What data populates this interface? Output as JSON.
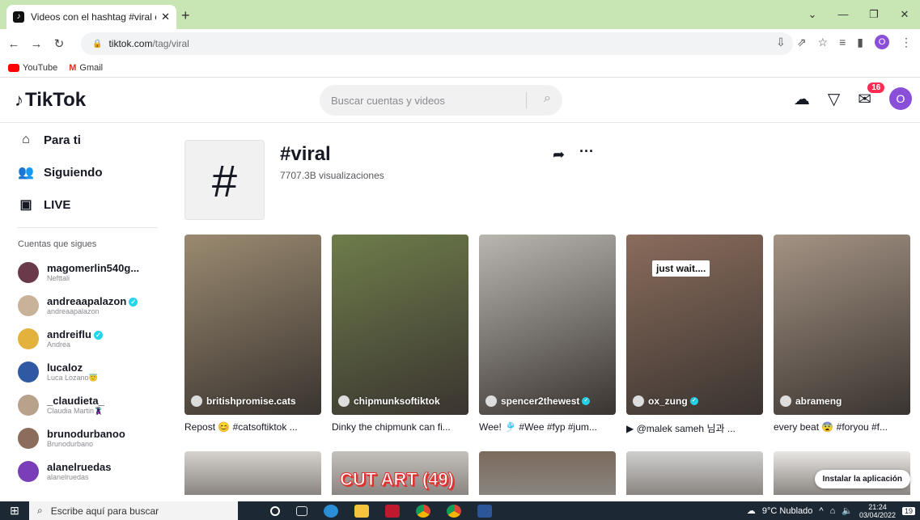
{
  "browser": {
    "tab_title": "Videos con el hashtag #viral en T",
    "tab_close": "✕",
    "new_tab": "+",
    "url_host": "tiktok.com",
    "url_path": "/tag/viral",
    "profile_initial": "O",
    "bookmarks": [
      "YouTube",
      "Gmail"
    ]
  },
  "header": {
    "logo": "TikTok",
    "search_placeholder": "Buscar cuentas y videos",
    "inbox_badge": "16",
    "user_initial": "O"
  },
  "sidebar": {
    "nav": [
      {
        "label": "Para ti",
        "icon": "home-icon",
        "glyph": "⌂"
      },
      {
        "label": "Siguiendo",
        "icon": "following-icon",
        "glyph": "👥"
      },
      {
        "label": "LIVE",
        "icon": "live-icon",
        "glyph": "▣"
      }
    ],
    "following_title": "Cuentas que sigues",
    "accounts": [
      {
        "name": "magomerlin540g...",
        "sub": "Nefttali",
        "verified": false,
        "color": "#6b3a4a"
      },
      {
        "name": "andreaapalazon",
        "sub": "andreaapalazon",
        "verified": true,
        "color": "#c9b29a"
      },
      {
        "name": "andreiflu",
        "sub": "Andrea",
        "verified": true,
        "color": "#e3b23c"
      },
      {
        "name": "lucaloz",
        "sub": "Luca Lozano😇",
        "verified": false,
        "color": "#2f5aa3"
      },
      {
        "name": "_claudieta_",
        "sub": "Claudia Martin🦹",
        "verified": false,
        "color": "#b9a28c"
      },
      {
        "name": "brunodurbanoo",
        "sub": "Brunodurbano",
        "verified": false,
        "color": "#8c6c5a"
      },
      {
        "name": "alanelruedas",
        "sub": "alanelruedas",
        "verified": false,
        "color": "#7a3fb8"
      }
    ]
  },
  "tag": {
    "symbol": "#",
    "name": "#viral",
    "views": "7707.3B visualizaciones"
  },
  "videos": [
    {
      "author": "britishpromise.cats",
      "verified": false,
      "caption": "Repost 😊 #catsoftiktok ...",
      "bg": "#9a8a70",
      "overlay": ""
    },
    {
      "author": "chipmunksoftiktok",
      "verified": false,
      "caption": "Dinky the chipmunk can fi...",
      "bg": "#6e7d4a",
      "overlay": ""
    },
    {
      "author": "spencer2thewest",
      "verified": true,
      "caption": "Wee! 🎐 #Wee #fyp #jum...",
      "bg": "#b9b6b0",
      "overlay": ""
    },
    {
      "author": "ox_zung",
      "verified": true,
      "caption": "▶ @malek sameh 님과 ...",
      "bg": "#8a6c5c",
      "overlay": "just wait...."
    },
    {
      "author": "abrameng",
      "verified": false,
      "caption": "every beat 😨 #foryou #f...",
      "bg": "#a49384",
      "overlay": ""
    }
  ],
  "row2": [
    {
      "bg": "#d6d2cd",
      "text": ""
    },
    {
      "bg": "#c4c0bc",
      "text": "CUT ART (49)"
    },
    {
      "bg": "#7a6a5c",
      "text": ""
    },
    {
      "bg": "#cfcfcf",
      "text": ""
    },
    {
      "bg": "#e9e7e4",
      "text": ""
    }
  ],
  "install_label": "Instalar la aplicación",
  "taskbar": {
    "search_placeholder": "Escribe aquí para buscar",
    "weather": "9°C  Nublado",
    "time": "21:24",
    "date": "03/04/2022",
    "notif_count": "19"
  }
}
